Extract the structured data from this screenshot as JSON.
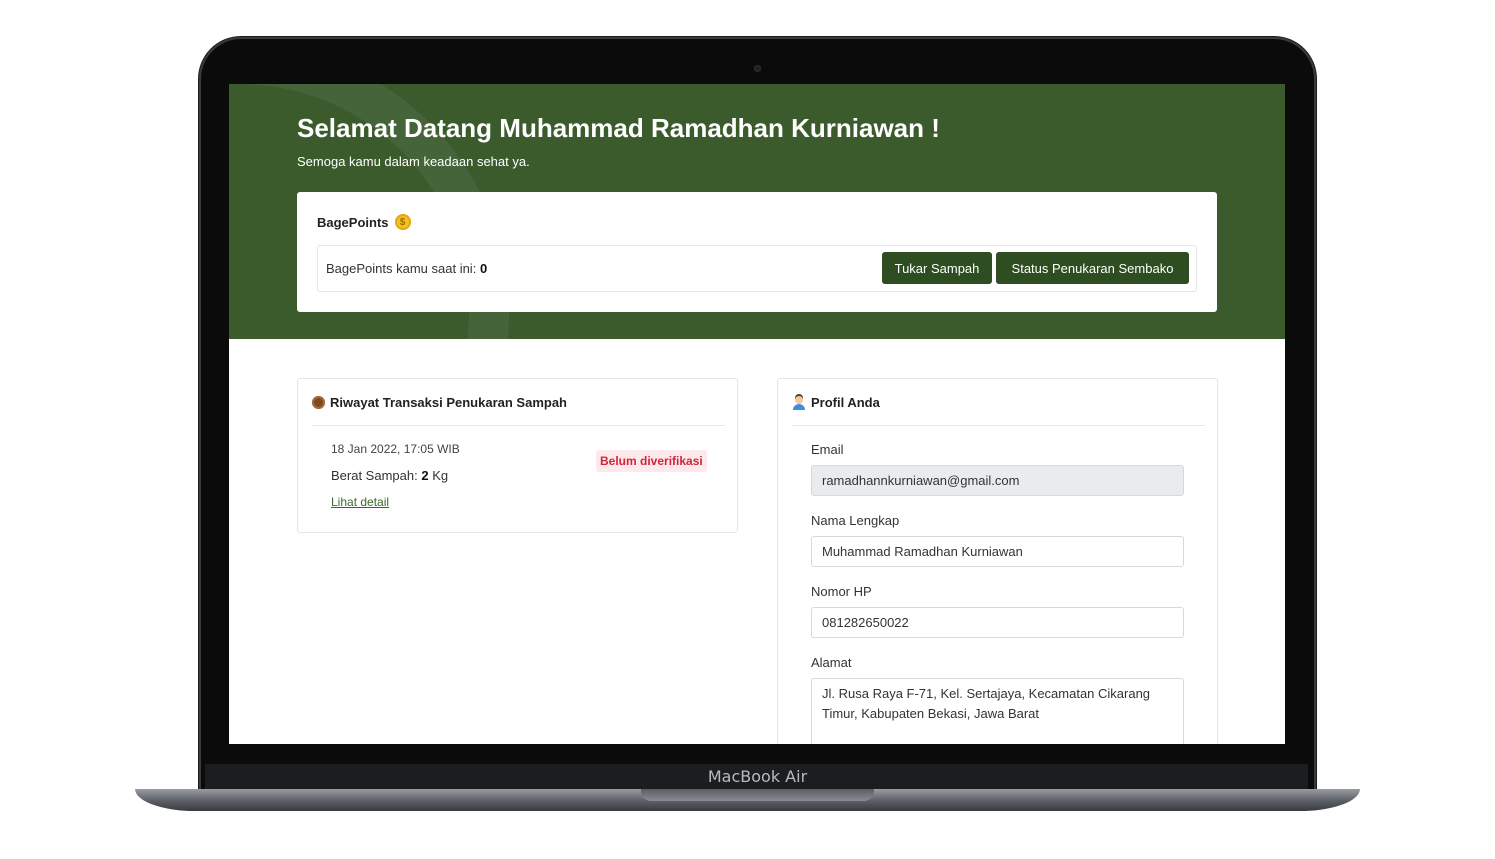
{
  "device_label": "MacBook Air",
  "hero": {
    "greeting": "Selamat Datang Muhammad Ramadhan Kurniawan !",
    "subtitle": "Semoga kamu dalam keadaan sehat ya."
  },
  "points": {
    "title": "BagePoints",
    "coin_symbol": "$",
    "label": "BagePoints kamu saat ini:",
    "value": "0",
    "btn_tukar": "Tukar Sampah",
    "btn_status": "Status Penukaran Sembako"
  },
  "riwayat": {
    "title": "Riwayat Transaksi Penukaran Sampah",
    "items": [
      {
        "date": "18 Jan 2022, 17:05 WIB",
        "weight_label": "Berat Sampah:",
        "weight_value": "2",
        "weight_unit": "Kg",
        "status": "Belum diverifikasi",
        "link": "Lihat detail"
      }
    ]
  },
  "profil": {
    "title": "Profil Anda",
    "email_label": "Email",
    "email_value": "ramadhannkurniawan@gmail.com",
    "name_label": "Nama Lengkap",
    "name_value": "Muhammad Ramadhan Kurniawan",
    "phone_label": "Nomor HP",
    "phone_value": "081282650022",
    "address_label": "Alamat",
    "address_value": "Jl. Rusa Raya F-71, Kel. Sertajaya, Kecamatan Cikarang Timur, Kabupaten Bekasi, Jawa Barat"
  },
  "colors": {
    "hero_bg": "#3b5b2d",
    "button_bg": "#2e4d20",
    "badge_text": "#d0253a",
    "link": "#3b6b2a"
  }
}
